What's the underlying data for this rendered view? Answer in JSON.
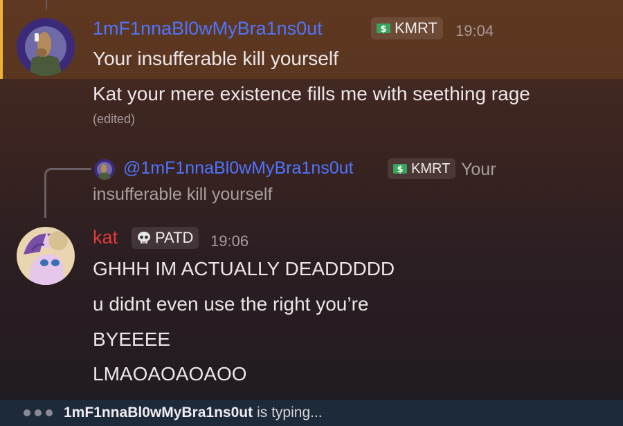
{
  "colors": {
    "highlight_accent": "#f0b232",
    "user1_name": "#4f74ff",
    "user2_name": "#e03c3c"
  },
  "messages": [
    {
      "author": "1mF1nnaBl0wMyBra1ns0ut",
      "tag": {
        "icon": "money-icon",
        "label": "KMRT"
      },
      "time": "19:04",
      "lines": [
        "Your insufferable kill yourself",
        "Kat your mere existence fills me with seething rage"
      ],
      "edited": "(edited)"
    },
    {
      "reply": {
        "author": "@1mF1nnaBl0wMyBra1ns0ut",
        "tag": {
          "icon": "money-icon",
          "label": "KMRT"
        },
        "text_part1": "Your",
        "text_part2": "insufferable kill yourself"
      },
      "author": "kat",
      "tag": {
        "icon": "skull-icon",
        "label": "PATD"
      },
      "time": "19:06",
      "lines": [
        "GHHH IM ACTUALLY DEADDDDD",
        "u didnt even use the right you’re",
        "BYEEEE",
        "LMAOAOAOAOO"
      ]
    }
  ],
  "typing": {
    "name": "1mF1nnaBl0wMyBra1ns0ut",
    "suffix": "is typing..."
  }
}
